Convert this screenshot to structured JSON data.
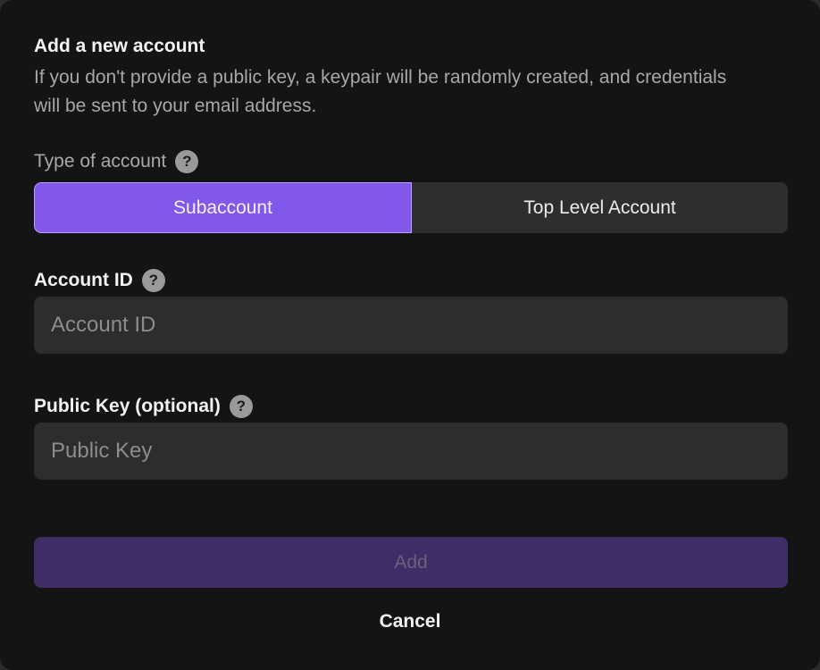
{
  "dialog": {
    "title": "Add a new account",
    "description": "If you don't provide a public key, a keypair will be randomly created, and credentials will be sent to your email address."
  },
  "account_type": {
    "label": "Type of account",
    "help_icon": "question-mark-icon",
    "help_glyph": "?",
    "options": [
      {
        "label": "Subaccount",
        "selected": true
      },
      {
        "label": "Top Level Account",
        "selected": false
      }
    ]
  },
  "account_id": {
    "label": "Account ID",
    "help_glyph": "?",
    "placeholder": "Account ID",
    "value": ""
  },
  "public_key": {
    "label": "Public Key (optional)",
    "help_glyph": "?",
    "placeholder": "Public Key",
    "value": ""
  },
  "actions": {
    "add_label": "Add",
    "add_disabled": true,
    "cancel_label": "Cancel"
  },
  "colors": {
    "accent": "#8258ea",
    "accent_disabled": "#3e2d66",
    "background": "#141414",
    "field": "#2d2d2d"
  }
}
